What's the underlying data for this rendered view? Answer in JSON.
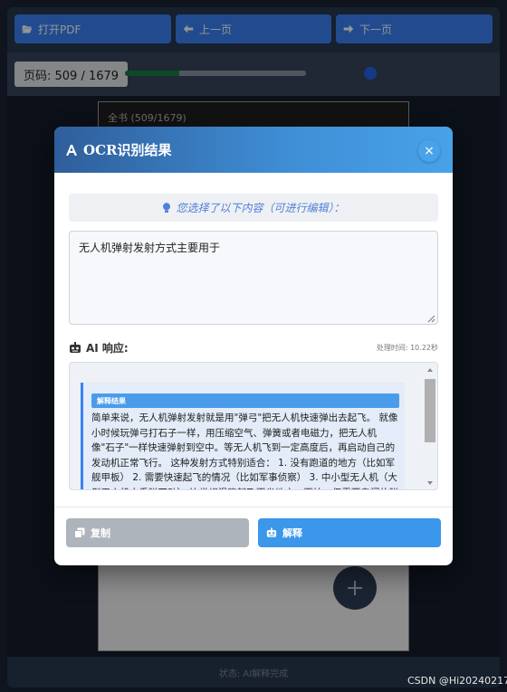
{
  "toolbar": {
    "open_pdf": "打开PDF",
    "prev_page": "上一页",
    "next_page": "下一页"
  },
  "pagebar": {
    "page_label": "页码: 509 / 1679",
    "progress_fraction": 0.3
  },
  "document": {
    "header": "全书 (509/1679)"
  },
  "statusbar": {
    "text": "状态: AI解释完成"
  },
  "modal": {
    "title": "OCR识别结果",
    "close_label": "×",
    "hint": "您选择了以下内容（可进行编辑）：",
    "input_value": "无人机弹射发射方式主要用于",
    "ai_label": "AI 响应:",
    "processing_time": "处理时间: 10.22秒",
    "response": {
      "badge": "解释结果",
      "text": "简单来说，无人机弹射发射就是用\"弹弓\"把无人机快速弹出去起飞。 就像小时候玩弹弓打石子一样，用压缩空气、弹簧或者电磁力，把无人机像\"石子\"一样快速弹射到空中。等无人机飞到一定高度后，再启动自己的发动机正常飞行。 这种发射方式特别适合： 1. 没有跑道的地方（比如军舰甲板） 2. 需要快速起飞的情况（比如军事侦察） 3. 中小型无人机（大型无人机太重弹不动） 比常规滑跑起飞更省地方，更快，但需要专门的弹射设备。"
    },
    "copy_button": "复制",
    "explain_button": "解释"
  },
  "watermark": "CSDN @Hi20240217",
  "colors": {
    "accent": "#3b82f6",
    "header_gradient_start": "#2f5e9b",
    "header_gradient_end": "#48a2e8",
    "copy_button": "#adb4bc",
    "explain_button": "#3a97ea"
  },
  "icons": {
    "open_pdf": "folder-open-icon",
    "prev_page": "arrow-left-icon",
    "next_page": "arrow-right-icon",
    "title": "font-icon",
    "hint": "lightbulb-icon",
    "ai": "robot-icon",
    "copy": "copy-icon",
    "explain": "robot-icon",
    "fab": "plus-icon"
  }
}
